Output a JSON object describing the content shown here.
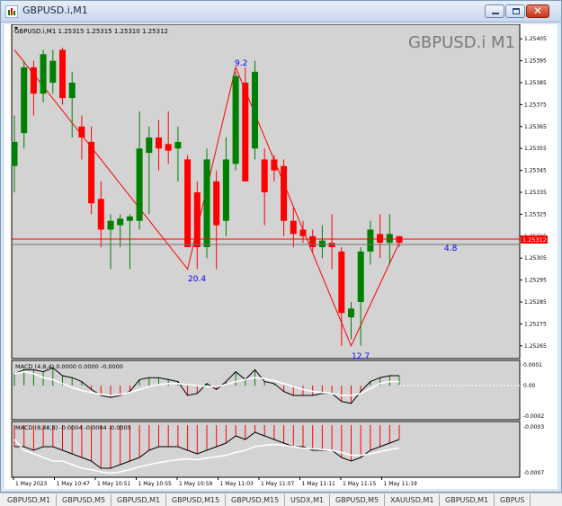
{
  "window": {
    "title": "GBPUSD.i,M1"
  },
  "chart": {
    "info_line": "GBPUSD.i,M1  1.25315 1.25315 1.25310 1.25312",
    "watermark": "GBPUSD.i M1",
    "bid_label": "1.25312",
    "annotations": [
      "9.2",
      "20.4",
      "12.7",
      "4.8"
    ]
  },
  "indicators": {
    "macd1_label": "MACD (4,8,4) 0.0000 0.0000 -0.0000",
    "macd1_ticks": [
      "0.0001",
      "0.00",
      "-0.0002"
    ],
    "macd2_label": "MACD (8,48,8) -0.0004 -0.0004 -0.0005",
    "macd2_ticks": [
      "-0.0003",
      "-0.0007"
    ]
  },
  "chart_data": {
    "type": "candlestick",
    "price_ticks": [
      "1.25405",
      "1.25395",
      "1.25385",
      "1.25375",
      "1.25365",
      "1.25355",
      "1.25345",
      "1.25335",
      "1.25325",
      "1.25315",
      "1.25305",
      "1.25295",
      "1.25285",
      "1.25275",
      "1.25265"
    ],
    "time_labels": [
      "1 May 2023",
      "1 May 10:47",
      "1 May 10:51",
      "1 May 10:55",
      "1 May 10:59",
      "1 May 11:03",
      "1 May 11:07",
      "1 May 11:11",
      "1 May 11:15",
      "1 May 11:19"
    ],
    "ylim": [
      1.2526,
      1.2541
    ],
    "candles": [
      {
        "o": 1.25347,
        "h": 1.2537,
        "l": 1.25335,
        "c": 1.25358
      },
      {
        "o": 1.25362,
        "h": 1.25395,
        "l": 1.25355,
        "c": 1.25392
      },
      {
        "o": 1.25392,
        "h": 1.25395,
        "l": 1.2537,
        "c": 1.2538
      },
      {
        "o": 1.2538,
        "h": 1.254,
        "l": 1.25376,
        "c": 1.25398
      },
      {
        "o": 1.25385,
        "h": 1.254,
        "l": 1.2538,
        "c": 1.25395
      },
      {
        "o": 1.254,
        "h": 1.25401,
        "l": 1.25375,
        "c": 1.25378
      },
      {
        "o": 1.25378,
        "h": 1.2539,
        "l": 1.2536,
        "c": 1.25385
      },
      {
        "o": 1.25365,
        "h": 1.2537,
        "l": 1.2535,
        "c": 1.2536
      },
      {
        "o": 1.25358,
        "h": 1.25365,
        "l": 1.25325,
        "c": 1.2533
      },
      {
        "o": 1.25332,
        "h": 1.2534,
        "l": 1.2531,
        "c": 1.25318
      },
      {
        "o": 1.25318,
        "h": 1.25325,
        "l": 1.253,
        "c": 1.25322
      },
      {
        "o": 1.2532,
        "h": 1.25325,
        "l": 1.2531,
        "c": 1.25323
      },
      {
        "o": 1.25322,
        "h": 1.25325,
        "l": 1.253,
        "c": 1.25324
      },
      {
        "o": 1.25322,
        "h": 1.25372,
        "l": 1.25318,
        "c": 1.25355
      },
      {
        "o": 1.25353,
        "h": 1.25365,
        "l": 1.25325,
        "c": 1.2536
      },
      {
        "o": 1.2536,
        "h": 1.25368,
        "l": 1.25345,
        "c": 1.25355
      },
      {
        "o": 1.25357,
        "h": 1.25372,
        "l": 1.25348,
        "c": 1.25354
      },
      {
        "o": 1.25355,
        "h": 1.25365,
        "l": 1.2534,
        "c": 1.25358
      },
      {
        "o": 1.2535,
        "h": 1.25352,
        "l": 1.2531,
        "c": 1.2531
      },
      {
        "o": 1.25335,
        "h": 1.2534,
        "l": 1.253,
        "c": 1.2531
      },
      {
        "o": 1.2531,
        "h": 1.25355,
        "l": 1.25305,
        "c": 1.2535
      },
      {
        "o": 1.2534,
        "h": 1.25345,
        "l": 1.253,
        "c": 1.2532
      },
      {
        "o": 1.25322,
        "h": 1.2536,
        "l": 1.25315,
        "c": 1.2535
      },
      {
        "o": 1.25348,
        "h": 1.2539,
        "l": 1.25345,
        "c": 1.25388
      },
      {
        "o": 1.25385,
        "h": 1.25392,
        "l": 1.2534,
        "c": 1.2534
      },
      {
        "o": 1.25355,
        "h": 1.25395,
        "l": 1.2535,
        "c": 1.2539
      },
      {
        "o": 1.2535,
        "h": 1.25355,
        "l": 1.2532,
        "c": 1.25335
      },
      {
        "o": 1.2535,
        "h": 1.25352,
        "l": 1.2534,
        "c": 1.25345
      },
      {
        "o": 1.25347,
        "h": 1.2535,
        "l": 1.25315,
        "c": 1.25322
      },
      {
        "o": 1.25322,
        "h": 1.25328,
        "l": 1.2531,
        "c": 1.25316
      },
      {
        "o": 1.25318,
        "h": 1.25322,
        "l": 1.25312,
        "c": 1.25315
      },
      {
        "o": 1.25315,
        "h": 1.25318,
        "l": 1.25308,
        "c": 1.2531
      },
      {
        "o": 1.2531,
        "h": 1.2532,
        "l": 1.25305,
        "c": 1.25313
      },
      {
        "o": 1.25312,
        "h": 1.25325,
        "l": 1.253,
        "c": 1.2531
      },
      {
        "o": 1.25308,
        "h": 1.2531,
        "l": 1.25265,
        "c": 1.2528
      },
      {
        "o": 1.25278,
        "h": 1.25285,
        "l": 1.25268,
        "c": 1.25282
      },
      {
        "o": 1.25285,
        "h": 1.2531,
        "l": 1.25265,
        "c": 1.25308
      },
      {
        "o": 1.25308,
        "h": 1.25322,
        "l": 1.25302,
        "c": 1.25318
      },
      {
        "o": 1.25316,
        "h": 1.25325,
        "l": 1.25305,
        "c": 1.25312
      },
      {
        "o": 1.25312,
        "h": 1.25325,
        "l": 1.25302,
        "c": 1.25316
      },
      {
        "o": 1.25315,
        "h": 1.25315,
        "l": 1.2531,
        "c": 1.25312
      }
    ],
    "zigzag": [
      {
        "i": 0,
        "v": 1.254
      },
      {
        "i": 18,
        "v": 1.253
      },
      {
        "i": 23,
        "v": 1.25392
      },
      {
        "i": 35,
        "v": 1.25265
      },
      {
        "i": 40,
        "v": 1.25312
      }
    ],
    "macd1_hist": [
      0.6,
      0.8,
      0.8,
      0.7,
      0.9,
      0.5,
      0.4,
      0.2,
      -0.2,
      -0.5,
      -0.6,
      -0.5,
      -0.3,
      0.3,
      0.4,
      0.4,
      0.3,
      0.2,
      -0.5,
      -0.4,
      0.1,
      -0.2,
      0.2,
      0.7,
      0.3,
      0.8,
      0.2,
      0.1,
      -0.3,
      -0.5,
      -0.5,
      -0.5,
      -0.4,
      -0.4,
      -0.8,
      -0.9,
      -0.3,
      0.2,
      0.4,
      0.5,
      0.5
    ],
    "macd1_signal": [
      0.6,
      0.7,
      0.6,
      0.4,
      0.3,
      0.1,
      -0.1,
      -0.25,
      -0.35,
      -0.45,
      -0.5,
      -0.45,
      -0.35,
      -0.2,
      -0.05,
      0.05,
      0.1,
      0.1,
      0.05,
      0.0,
      -0.05,
      -0.05,
      0.05,
      0.2,
      0.3,
      0.4,
      0.35,
      0.25,
      0.1,
      -0.05,
      -0.2,
      -0.3,
      -0.35,
      -0.4,
      -0.5,
      -0.5,
      -0.4,
      -0.15,
      0.1,
      0.2,
      0.2
    ],
    "macd2_hist": [
      -0.3,
      -0.3,
      -0.35,
      -0.3,
      -0.3,
      -0.35,
      -0.4,
      -0.45,
      -0.5,
      -0.6,
      -0.6,
      -0.55,
      -0.5,
      -0.45,
      -0.35,
      -0.3,
      -0.3,
      -0.3,
      -0.35,
      -0.4,
      -0.35,
      -0.3,
      -0.25,
      -0.15,
      -0.2,
      -0.1,
      -0.15,
      -0.2,
      -0.25,
      -0.3,
      -0.3,
      -0.35,
      -0.35,
      -0.35,
      -0.45,
      -0.5,
      -0.45,
      -0.35,
      -0.3,
      -0.25,
      -0.2
    ],
    "macd2_signal": [
      -0.2,
      -0.35,
      -0.4,
      -0.45,
      -0.5,
      -0.5,
      -0.55,
      -0.6,
      -0.62,
      -0.65,
      -0.67,
      -0.65,
      -0.62,
      -0.58,
      -0.55,
      -0.52,
      -0.5,
      -0.48,
      -0.47,
      -0.48,
      -0.46,
      -0.44,
      -0.42,
      -0.38,
      -0.35,
      -0.3,
      -0.28,
      -0.27,
      -0.28,
      -0.3,
      -0.32,
      -0.33,
      -0.34,
      -0.35,
      -0.38,
      -0.42,
      -0.42,
      -0.4,
      -0.37,
      -0.34,
      -0.32
    ]
  },
  "status_tabs": [
    "GBPUSD,M1",
    "GBPUSD,M5",
    "GBPUSD,M1",
    "GBPUSD,M15",
    "GBPUSD,M15",
    "USDX,M1",
    "GBPUSD,M5",
    "XAUUSD,M1",
    "GBPUSD,M1",
    "GBPUS"
  ],
  "colors": {
    "bull": "#008000",
    "bear": "#ff0000",
    "background": "#d3d3d3",
    "zigzag": "#ff0000",
    "annotation": "#0000ff",
    "bid_line": "#ff0000"
  }
}
